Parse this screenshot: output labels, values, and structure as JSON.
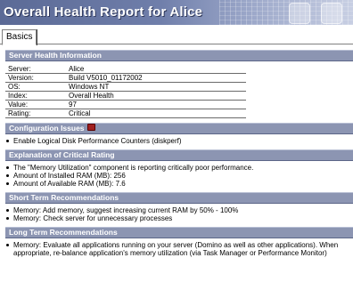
{
  "window": {
    "title": "Overall Health Report for Alice"
  },
  "tabs": [
    {
      "label": "Basics"
    }
  ],
  "sections": {
    "server_health": {
      "title": "Server Health Information",
      "rows": [
        {
          "key": "Server:",
          "value": "Alice"
        },
        {
          "key": "Version:",
          "value": "Build V5010_01172002"
        },
        {
          "key": "OS:",
          "value": "Windows NT"
        },
        {
          "key": "Index:",
          "value": "Overall Health"
        },
        {
          "key": "Value:",
          "value": "97"
        },
        {
          "key": "Rating:",
          "value": "Critical"
        }
      ]
    },
    "config_issues": {
      "title": "Configuration Issues",
      "badge_icon": "issue-icon",
      "items": [
        "Enable Logical Disk Performance Counters (diskperf)"
      ]
    },
    "critical_rating": {
      "title": "Explanation of Critical Rating",
      "items": [
        "The \"Memory Utilization\" component is reporting critically poor performance.",
        "Amount of Installed RAM (MB):  256",
        "Amount of Available RAM (MB):  7.6"
      ]
    },
    "short_term": {
      "title": "Short Term Recommendations",
      "items": [
        "Memory: Add memory, suggest increasing current RAM by 50% - 100%",
        "Memory: Check server for unnecessary processes"
      ]
    },
    "long_term": {
      "title": "Long Term Recommendations",
      "items": [
        "Memory: Evaluate all applications running on your server (Domino as well as other applications).  When appropriate, re-balance application's memory utilization (via Task Manager or Performance Monitor)"
      ]
    }
  },
  "colors": {
    "banner": "#6f7eaa",
    "section_header": "#8c95b2"
  }
}
